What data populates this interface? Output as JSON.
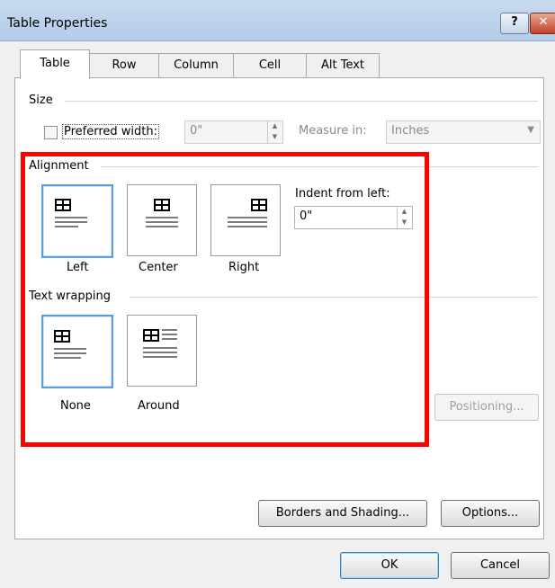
{
  "window": {
    "title": "Table Properties",
    "help_label": "?",
    "close_label": "✕"
  },
  "tabs": [
    "Table",
    "Row",
    "Column",
    "Cell",
    "Alt Text"
  ],
  "size": {
    "heading": "Size",
    "preferred_width_label": "Preferred width:",
    "preferred_width_value": "0\"",
    "measure_in_label": "Measure in:",
    "measure_in_value": "Inches"
  },
  "alignment": {
    "heading": "Alignment",
    "options": [
      "Left",
      "Center",
      "Right"
    ],
    "selected": "Left",
    "indent_label": "Indent from left:",
    "indent_value": "0\""
  },
  "text_wrapping": {
    "heading": "Text wrapping",
    "options": [
      "None",
      "Around"
    ],
    "selected": "None"
  },
  "buttons": {
    "positioning": "Positioning...",
    "borders_shading": "Borders and Shading...",
    "options": "Options...",
    "ok": "OK",
    "cancel": "Cancel"
  },
  "highlight_color": "#ff0000",
  "selection_color": "#5a9de0"
}
